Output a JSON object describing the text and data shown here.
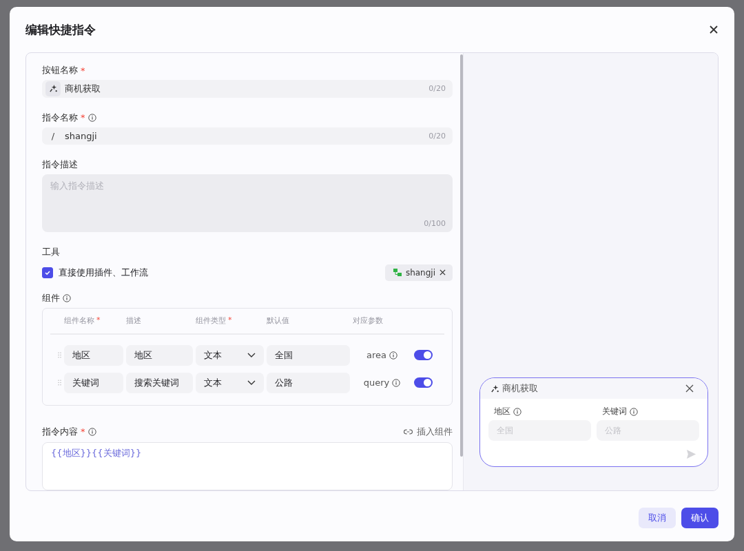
{
  "dialog": {
    "title": "编辑快捷指令"
  },
  "form": {
    "button_name": {
      "label": "按钮名称",
      "required_mark": "*",
      "value": "商机获取",
      "counter": "0/20"
    },
    "command_name": {
      "label": "指令名称",
      "required_mark": "*",
      "prefix": "/",
      "value": "shangji",
      "counter": "0/20"
    },
    "description": {
      "label": "指令描述",
      "placeholder": "输入指令描述",
      "counter": "0/100"
    },
    "tools": {
      "label": "工具",
      "checkbox_label": "直接使用插件、工作流",
      "checked": true,
      "tag": "shangji"
    },
    "components": {
      "label": "组件",
      "columns": [
        {
          "label": "组件名称",
          "required_mark": "*"
        },
        {
          "label": "描述"
        },
        {
          "label": "组件类型",
          "required_mark": "*"
        },
        {
          "label": "默认值"
        },
        {
          "label": "对应参数"
        }
      ],
      "rows": [
        {
          "name": "地区",
          "description": "地区",
          "type": "文本",
          "default": "全国",
          "param": "area",
          "on": true
        },
        {
          "name": "关键词",
          "description": "搜索关键词",
          "type": "文本",
          "default": "公路",
          "param": "query",
          "on": true
        }
      ]
    },
    "content": {
      "label": "指令内容",
      "required_mark": "*",
      "insert_link": "插入组件",
      "value": "{{地区}}{{关键词}}"
    }
  },
  "preview": {
    "title": "商机获取",
    "fields": [
      {
        "label": "地区",
        "placeholder": "全国"
      },
      {
        "label": "关键词",
        "placeholder": "公路"
      }
    ]
  },
  "buttons": [
    {
      "label": "取消",
      "kind": "secondary"
    },
    {
      "label": "确认",
      "kind": "primary"
    }
  ]
}
